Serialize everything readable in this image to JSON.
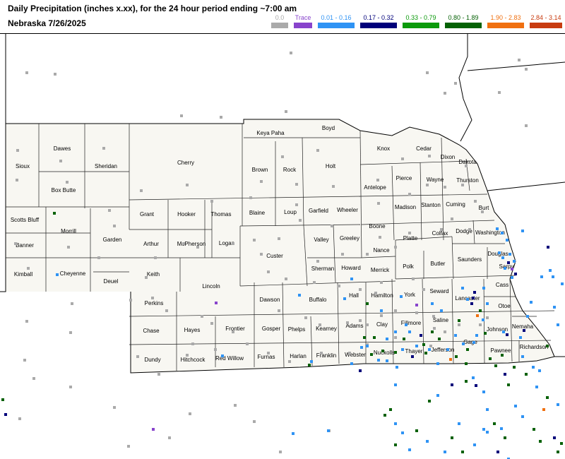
{
  "header": {
    "title": "Daily Precipitation (inches  x.xx),  for the 24 hour period ending ~7:00 am",
    "subtitle": "Nebraska 7/26/2025"
  },
  "legend": [
    {
      "label": "0.0",
      "color": "#aaaaaa",
      "label_color": "#aaaaaa"
    },
    {
      "label": "Trace",
      "color": "#8844cc",
      "label_color": "#8844cc"
    },
    {
      "label": "0.01 - 0.16",
      "color": "#2f93f4",
      "label_color": "#2f93f4"
    },
    {
      "label": "0.17 - 0.32",
      "color": "#00007a",
      "label_color": "#00007a"
    },
    {
      "label": "0.33 - 0.79",
      "color": "#0c9a0c",
      "label_color": "#0c9a0c"
    },
    {
      "label": "0.80 - 1.89",
      "color": "#056105",
      "label_color": "#056105"
    },
    {
      "label": "1.90 - 2.83",
      "color": "#f07010",
      "label_color": "#f07010"
    },
    {
      "label": "2.84 - 3.14",
      "color": "#c83c10",
      "label_color": "#c83c10"
    }
  ],
  "counties": [
    "Sioux",
    "Dawes",
    "Sheridan",
    "Cherry",
    "Keya Paha",
    "Boyd",
    "Knox",
    "Cedar",
    "Dixon",
    "Dakota",
    "Box Butte",
    "Brown",
    "Rock",
    "Holt",
    "Antelope",
    "Pierce",
    "Wayne",
    "Thurston",
    "Scotts Bluff",
    "Morrill",
    "Grant",
    "Hooker",
    "Thomas",
    "Blaine",
    "Loup",
    "Garfield",
    "Wheeler",
    "Madison",
    "Stanton",
    "Cuming",
    "Burt",
    "Banner",
    "Garden",
    "Arthur",
    "McPherson",
    "Logan",
    "Custer",
    "Valley",
    "Greeley",
    "Boone",
    "Platte",
    "Colfax",
    "Dodge",
    "Washington",
    "Nance",
    "Douglas",
    "Kimball",
    "Cheyenne",
    "Deuel",
    "Keith",
    "Lincoln",
    "Sherman",
    "Howard",
    "Merrick",
    "Polk",
    "Butler",
    "Saunders",
    "Sarpy",
    "Perkins",
    "Dawson",
    "Buffalo",
    "Hall",
    "Hamilton",
    "York",
    "Seward",
    "Lancaster",
    "Cass",
    "Otoe",
    "Chase",
    "Hayes",
    "Frontier",
    "Gosper",
    "Phelps",
    "Kearney",
    "Adams",
    "Clay",
    "Fillmore",
    "Saline",
    "Johnson",
    "Nemaha",
    "Dundy",
    "Hitchcock",
    "Red Willow",
    "Furnas",
    "Harlan",
    "Franklin",
    "Webster",
    "Nuckolls",
    "Thayer",
    "Jefferson",
    "Gage",
    "Pawnee",
    "Richardson"
  ]
}
